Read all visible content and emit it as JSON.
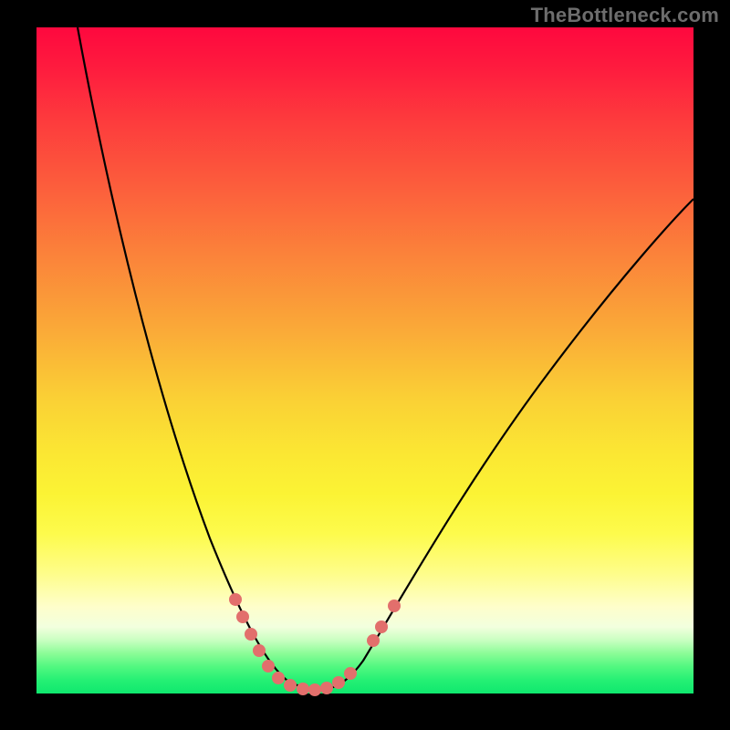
{
  "watermark": "TheBottleneck.com",
  "chart_data": {
    "type": "line",
    "title": "",
    "xlabel": "",
    "ylabel": "",
    "xlim": [
      0,
      100
    ],
    "ylim": [
      0,
      100
    ],
    "grid": false,
    "legend": false,
    "annotations": [
      "TheBottleneck.com"
    ],
    "background_gradient": {
      "orientation": "vertical",
      "stops": [
        {
          "pos": 0.0,
          "color": "#fe083e"
        },
        {
          "pos": 0.25,
          "color": "#fc5e3c"
        },
        {
          "pos": 0.55,
          "color": "#fad135"
        },
        {
          "pos": 0.8,
          "color": "#fefd8a"
        },
        {
          "pos": 0.92,
          "color": "#c9ffc1"
        },
        {
          "pos": 1.0,
          "color": "#0fe86e"
        }
      ]
    },
    "series": [
      {
        "name": "bottleneck-curve",
        "style": "solid",
        "color": "#000000",
        "x": [
          6,
          12,
          18,
          24,
          30,
          34,
          38,
          42,
          45,
          48,
          52,
          58,
          66,
          76,
          88,
          100
        ],
        "y": [
          100,
          74,
          48,
          28,
          14,
          8,
          3,
          1,
          0,
          1,
          5,
          14,
          30,
          48,
          64,
          74
        ]
      },
      {
        "name": "highlight-range",
        "style": "dots",
        "color": "#e26f6c",
        "x": [
          30,
          32,
          34,
          36,
          38,
          40,
          42,
          44,
          46,
          48,
          50,
          52,
          54
        ],
        "y": [
          14,
          11,
          8,
          5,
          3,
          1.5,
          1,
          0.5,
          1,
          2,
          5,
          9,
          13
        ]
      }
    ]
  }
}
